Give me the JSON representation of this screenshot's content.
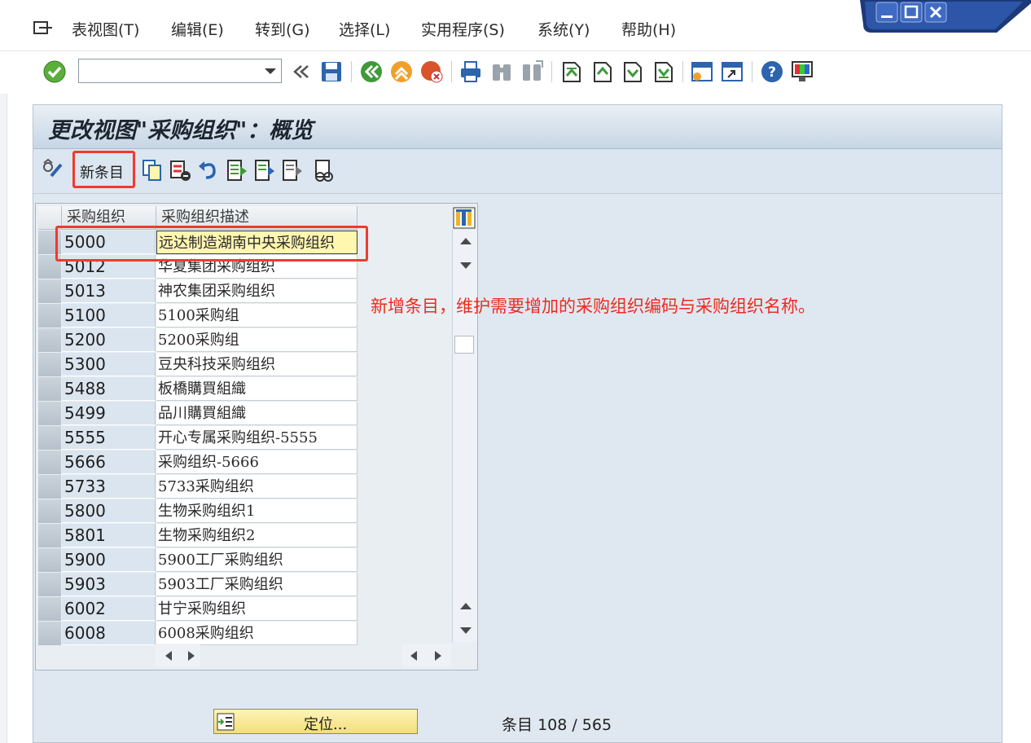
{
  "menu": {
    "items": [
      "表视图(T)",
      "编辑(E)",
      "转到(G)",
      "选择(L)",
      "实用程序(S)",
      "系统(Y)",
      "帮助(H)"
    ]
  },
  "window_controls": [
    "minimize-icon",
    "maximize-icon",
    "close-icon"
  ],
  "toolbar": {
    "command_value": "",
    "icons": [
      "enter-check-icon",
      "back-arrows-icon",
      "save-icon",
      "back-icon",
      "exit-icon",
      "cancel-icon",
      "print-icon",
      "find-icon",
      "find-next-icon",
      "first-page-icon",
      "previous-page-icon",
      "next-page-icon",
      "last-page-icon",
      "new-session-icon",
      "shortcut-icon",
      "help-icon",
      "layout-icon"
    ]
  },
  "page": {
    "title": "更改视图\"采购组织\"：概览"
  },
  "app_toolbar": {
    "new_entry_label": "新条目"
  },
  "table": {
    "columns": [
      "采购组织",
      "采购组织描述"
    ],
    "rows": [
      {
        "key": "5000",
        "desc": "远达制造湖南中央采购组织"
      },
      {
        "key": "5012",
        "desc": "华夏集团采购组织"
      },
      {
        "key": "5013",
        "desc": "神农集团采购组织"
      },
      {
        "key": "5100",
        "desc": "5100采购组"
      },
      {
        "key": "5200",
        "desc": "5200采购组"
      },
      {
        "key": "5300",
        "desc": "豆央科技采购组织"
      },
      {
        "key": "5488",
        "desc": "板橋購買組織"
      },
      {
        "key": "5499",
        "desc": "品川購買組織"
      },
      {
        "key": "5555",
        "desc": "开心专属采购组织-5555"
      },
      {
        "key": "5666",
        "desc": "采购组织-5666"
      },
      {
        "key": "5733",
        "desc": "5733采购组织"
      },
      {
        "key": "5800",
        "desc": "生物采购组织1"
      },
      {
        "key": "5801",
        "desc": "生物采购组织2"
      },
      {
        "key": "5900",
        "desc": "5900工厂采购组织"
      },
      {
        "key": "5903",
        "desc": "5903工厂采购组织"
      },
      {
        "key": "6002",
        "desc": "甘宁采购组织"
      },
      {
        "key": "6008",
        "desc": "6008采购组织"
      }
    ]
  },
  "annotation": {
    "text": "新增条目，维护需要增加的采购组织编码与采购组织名称。"
  },
  "bottom": {
    "position_button": "定位...",
    "entries_label": "条目",
    "entries_count": "108 / 565"
  },
  "colors": {
    "highlight_red": "#f03a2e",
    "panel_bg": "#dfe8f1",
    "active_cell": "#fff6b0",
    "button_yellow": "#f2de7a"
  }
}
